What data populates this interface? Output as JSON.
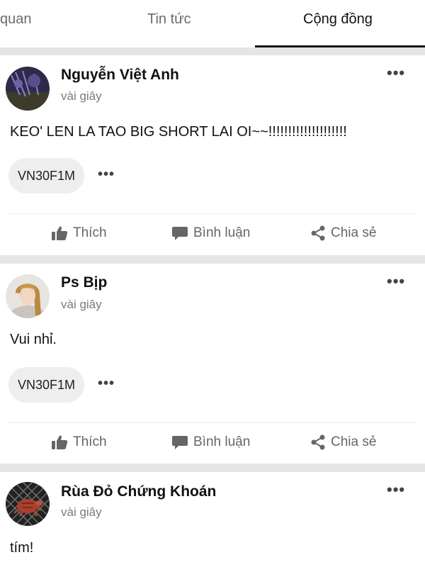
{
  "tabs": [
    {
      "label": "quan"
    },
    {
      "label": "Tin tức"
    },
    {
      "label": "Cộng đồng",
      "active": true
    }
  ],
  "actions": {
    "like_label": "Thích",
    "comment_label": "Bình luận",
    "share_label": "Chia sẻ"
  },
  "posts": [
    {
      "author": "Nguyễn Việt Anh",
      "time": "vài giây",
      "content": "KEO' LEN LA TAO BIG SHORT LAI OI~~!!!!!!!!!!!!!!!!!!!!",
      "tag": "VN30F1M"
    },
    {
      "author": "Ps Bịp",
      "time": "vài giây",
      "content": "Vui nhỉ.",
      "tag": "VN30F1M"
    },
    {
      "author": "Rùa Đỏ Chứng Khoán",
      "time": "vài giây",
      "content": "tím!"
    }
  ],
  "colors": {
    "background": "#ffffff",
    "separator": "#e5e5e5",
    "chip": "#eeeeee",
    "muted_text": "#7a7a7a",
    "active_tab_underline": "#111111"
  },
  "icons": {
    "more": "more-horizontal-icon",
    "like": "thumbs-up-icon",
    "comment": "comment-bubble-icon",
    "share": "share-icon"
  }
}
